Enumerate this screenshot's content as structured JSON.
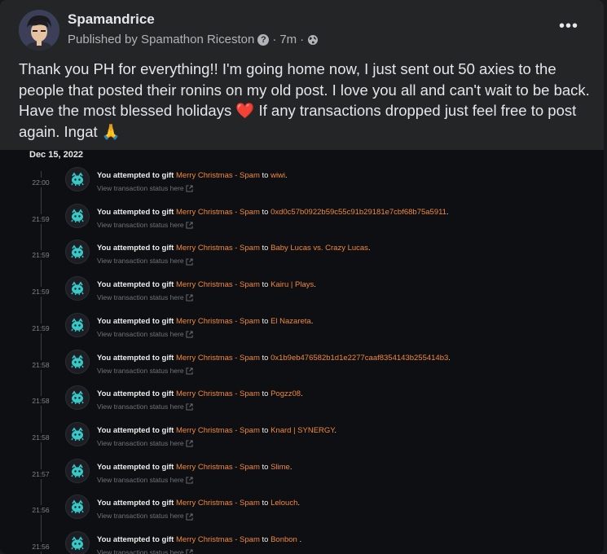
{
  "post": {
    "author": "Spamandrice",
    "published_by": "Published by Spamathon Riceston",
    "time": "7m",
    "separator": "·",
    "more": "•••",
    "text": "Thank you PH for everything!! I'm going home now, I just sent out 50 axies to the people that posted their ronins on my old post. I love you all and can't wait to be back. Have the most blessed holidays ❤️ If any transactions dropped just feel free to post again. Ingat 🙏"
  },
  "feed": {
    "date": "Dec 15, 2022",
    "attempt_prefix": "You attempted to gift",
    "item_name": "Merry Christmas - Spam",
    "to": "to",
    "status_link": "View transaction status here",
    "entries": [
      {
        "time": "22:00",
        "recipient": "wiwi",
        "suffix": "."
      },
      {
        "time": "21:59",
        "recipient": "0xd0c57b0922b59c55c91b29181e7cbf68b75a5911",
        "suffix": "."
      },
      {
        "time": "21:59",
        "recipient": "Baby Lucas vs. Crazy Lucas",
        "suffix": "."
      },
      {
        "time": "21:59",
        "recipient": "Kairu | Plays",
        "suffix": "."
      },
      {
        "time": "21:59",
        "recipient": "El Nazareta",
        "suffix": "."
      },
      {
        "time": "21:58",
        "recipient": "0x1b9eb476582b1d1e2277caaf8354143b255414b3",
        "suffix": "."
      },
      {
        "time": "21:58",
        "recipient": "Pogzz08",
        "suffix": "."
      },
      {
        "time": "21:58",
        "recipient": "Knard | SYNERGY",
        "suffix": "."
      },
      {
        "time": "21:57",
        "recipient": "Slime",
        "suffix": "."
      },
      {
        "time": "21:56",
        "recipient": "Lelouch",
        "suffix": "."
      },
      {
        "time": "21:56",
        "recipient": "Bonbon",
        "suffix": " ."
      }
    ]
  },
  "colors": {
    "accent_orange": "#f0883e",
    "axie_teal": "#37c8c8"
  }
}
